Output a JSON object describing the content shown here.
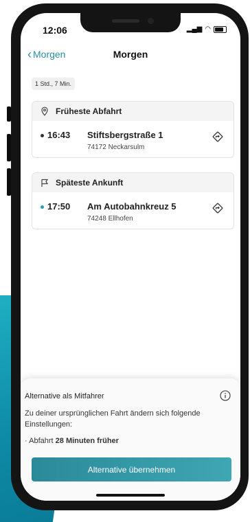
{
  "status_bar": {
    "time": "12:06"
  },
  "nav": {
    "back_label": "Morgen",
    "title": "Morgen"
  },
  "duration": "1 Std., 7 Min.",
  "departure": {
    "header": "Früheste Abfahrt",
    "time": "16:43",
    "street": "Stiftsbergstraße 1",
    "city": "74172 Neckarsulm",
    "dot_color": "#333333"
  },
  "arrival": {
    "header": "Späteste Ankunft",
    "time": "17:50",
    "street": "Am Autobahnkreuz 5",
    "city": "74248 Ellhofen",
    "dot_color": "#2a9fb5"
  },
  "sheet": {
    "title": "Alternative als Mitfahrer",
    "text": "Zu deiner ursprünglichen Fahrt ändern sich folgende Einstellungen:",
    "bullet_prefix": "Abfahrt",
    "bullet_value": "28 Minuten früher",
    "cta_label": "Alternative übernehmen"
  },
  "colors": {
    "accent": "#2a8fa8",
    "cta": "#3a9aaa",
    "teal_bg": "#0e8aa6"
  }
}
